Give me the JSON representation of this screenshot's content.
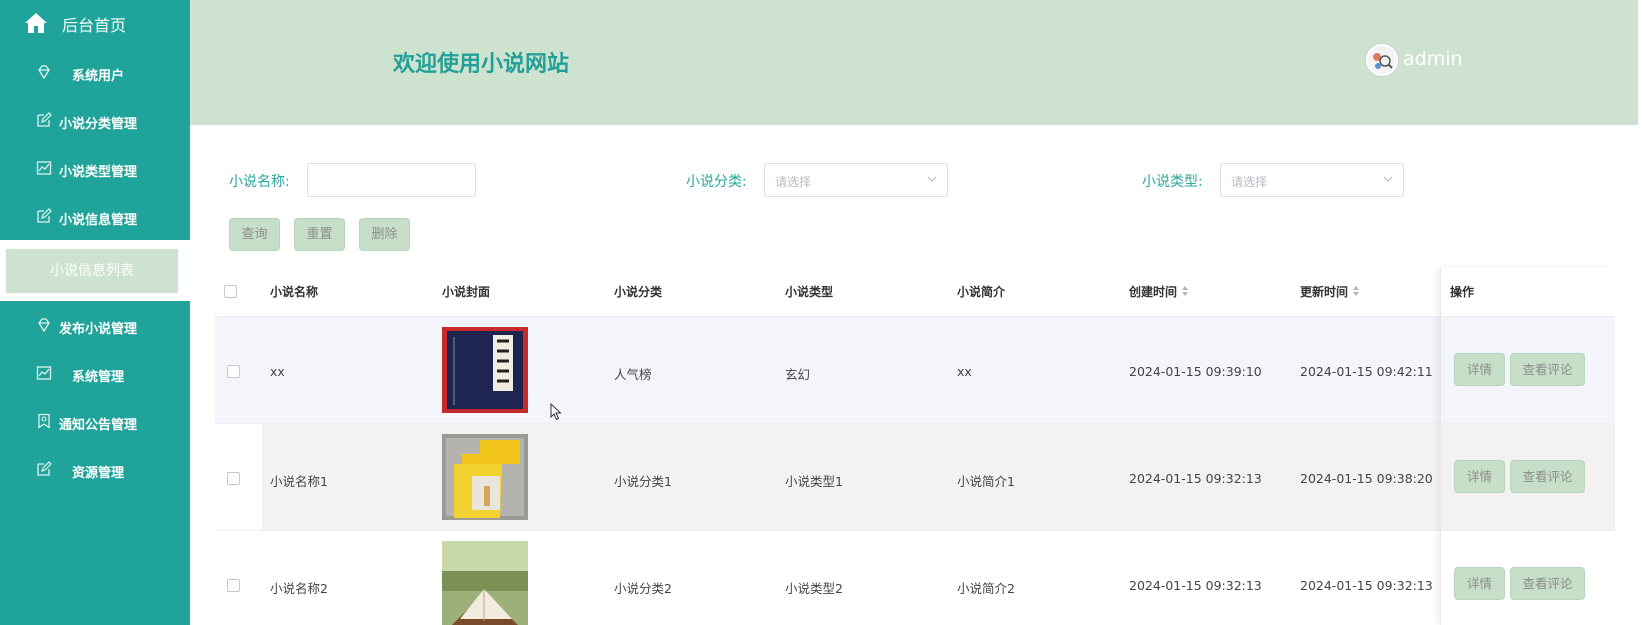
{
  "sidebar": {
    "home_label": "后台首页",
    "items": [
      {
        "label": "系统用户",
        "icon": "diamond-icon"
      },
      {
        "label": "小说分类管理",
        "icon": "edit-icon"
      },
      {
        "label": "小说类型管理",
        "icon": "chart-icon"
      },
      {
        "label": "小说信息管理",
        "icon": "edit-icon"
      },
      {
        "label": "发布小说管理",
        "icon": "diamond-icon"
      },
      {
        "label": "系统管理",
        "icon": "chart-icon"
      },
      {
        "label": "通知公告管理",
        "icon": "bookmark-icon"
      },
      {
        "label": "资源管理",
        "icon": "edit-icon"
      }
    ],
    "active_sub": "小说信息列表"
  },
  "header": {
    "welcome": "欢迎使用小说网站",
    "username": "admin"
  },
  "filters": {
    "name_label": "小说名称:",
    "name_value": "",
    "category_label": "小说分类:",
    "category_placeholder": "请选择",
    "type_label": "小说类型:",
    "type_placeholder": "请选择"
  },
  "actions": {
    "query": "查询",
    "reset": "重置",
    "delete": "删除"
  },
  "table": {
    "columns": [
      "小说名称",
      "小说封面",
      "小说分类",
      "小说类型",
      "小说简介",
      "创建时间",
      "更新时间",
      "操作"
    ],
    "rows": [
      {
        "name": "xx",
        "category": "人气榜",
        "type": "玄幻",
        "intro": "xx",
        "created": "2024-01-15 09:39:10",
        "updated": "2024-01-15 09:42:11",
        "cover": "dark-book-cover"
      },
      {
        "name": "小说名称1",
        "category": "小说分类1",
        "type": "小说类型1",
        "intro": "小说简介1",
        "created": "2024-01-15 09:32:13",
        "updated": "2024-01-15 09:38:20",
        "cover": "yellow-book-cover"
      },
      {
        "name": "小说名称2",
        "category": "小说分类2",
        "type": "小说类型2",
        "intro": "小说简介2",
        "created": "2024-01-15 09:32:13",
        "updated": "2024-01-15 09:32:13",
        "cover": "open-book-photo"
      }
    ],
    "detail_label": "详情",
    "comment_label": "查看评论"
  },
  "colors": {
    "sidebar": "#20a39a",
    "header": "#cde3cf",
    "accent_text": "#22a098",
    "button": "#c7dfc9"
  }
}
